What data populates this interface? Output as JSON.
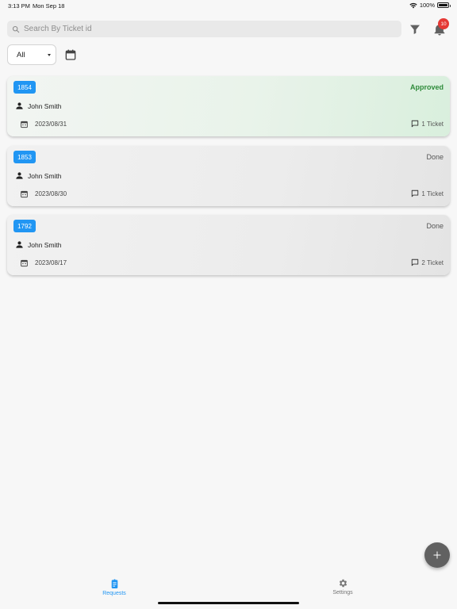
{
  "status_bar": {
    "time": "3:13 PM",
    "date": "Mon Sep 18",
    "battery": "100%"
  },
  "search": {
    "placeholder": "Search By Ticket id",
    "value": ""
  },
  "notifications": {
    "count": "10"
  },
  "filter": {
    "selected": "All"
  },
  "requests": [
    {
      "id": "1854",
      "status": "Approved",
      "user": "John Smith",
      "date": "2023/08/31",
      "tickets": "1 Ticket"
    },
    {
      "id": "1853",
      "status": "Done",
      "user": "John Smith",
      "date": "2023/08/30",
      "tickets": "1 Ticket"
    },
    {
      "id": "1792",
      "status": "Done",
      "user": "John Smith",
      "date": "2023/08/17",
      "tickets": "2 Ticket"
    }
  ],
  "bottom_nav": {
    "requests_label": "Requests",
    "settings_label": "Settings"
  },
  "colors": {
    "accent": "#2196f3",
    "approved": "#2e8b3a",
    "badge": "#e53935",
    "fab": "#616161"
  },
  "icons": [
    "search-icon",
    "filter-icon",
    "bell-icon",
    "calendar-icon",
    "person-icon",
    "comment-icon",
    "add-icon",
    "clipboard-icon",
    "gear-icon",
    "wifi-icon",
    "battery-icon"
  ]
}
